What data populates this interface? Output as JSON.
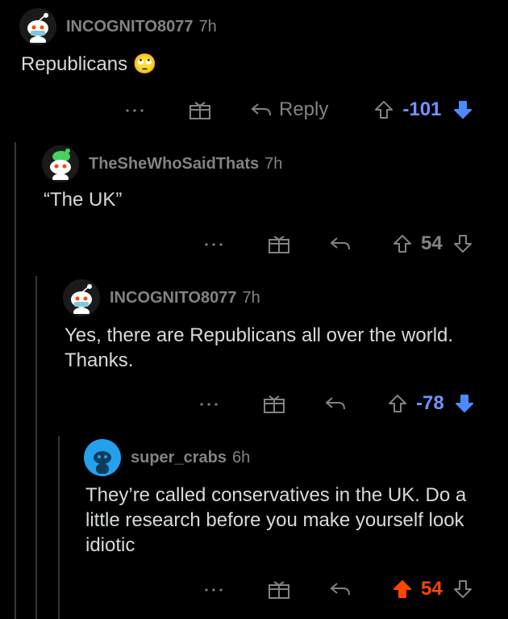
{
  "comments": [
    {
      "username": "INCOGNITO8077",
      "time": "7h",
      "body": "Republicans",
      "emoji": "🙄",
      "reply_label": "Reply",
      "score": "-101",
      "vote": "down",
      "avatar": "snoo-masked-avatar"
    },
    {
      "username": "TheSheWhoSaidThats",
      "time": "7h",
      "body": "“The UK”",
      "score": "54",
      "vote": "none",
      "avatar": "snoo-green-cap-avatar"
    },
    {
      "username": "INCOGNITO8077",
      "time": "7h",
      "body": "Yes, there are Republicans all over the world. Thanks.",
      "score": "-78",
      "vote": "down",
      "avatar": "snoo-masked-avatar"
    },
    {
      "username": "super_crabs",
      "time": "6h",
      "body": "They’re called conservatives in the UK. Do a little research before you make yourself look idiotic",
      "score": "54",
      "vote": "up",
      "avatar": "snoo-default-avatar"
    }
  ],
  "colors": {
    "background": "#000000",
    "text": "#d7dadc",
    "meta": "#818384",
    "downvote": "#7193ff",
    "downvote_arrow": "#4a8cff",
    "upvote": "#ff4500",
    "thread_line": "#343536",
    "avatar_cyan": "#24a0ed"
  }
}
